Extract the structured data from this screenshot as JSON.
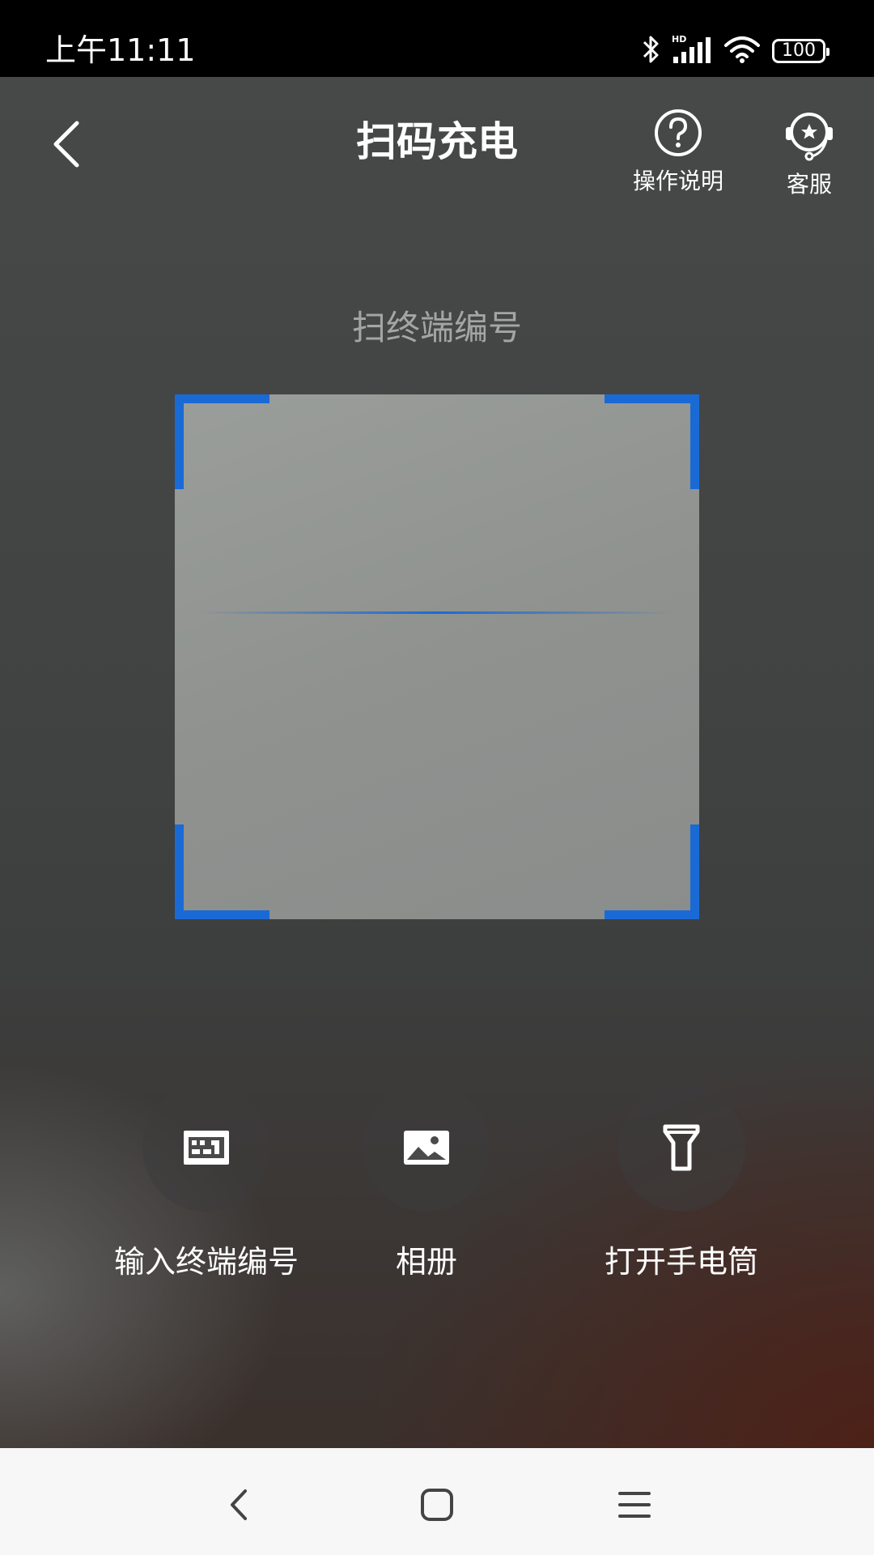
{
  "status_bar": {
    "time": "上午11:11",
    "battery": "100",
    "icons": [
      "bluetooth-icon",
      "hd-signal-icon",
      "wifi-icon",
      "battery-icon"
    ]
  },
  "header": {
    "title": "扫码充电",
    "help_label": "操作说明",
    "service_label": "客服"
  },
  "scanner": {
    "hint": "扫终端编号",
    "frame_color": "#1a6ad6"
  },
  "actions": {
    "input_label": "输入终端编号",
    "album_label": "相册",
    "flashlight_label": "打开手电筒"
  },
  "nav": {
    "icons": [
      "back-icon",
      "home-icon",
      "menu-icon"
    ]
  }
}
